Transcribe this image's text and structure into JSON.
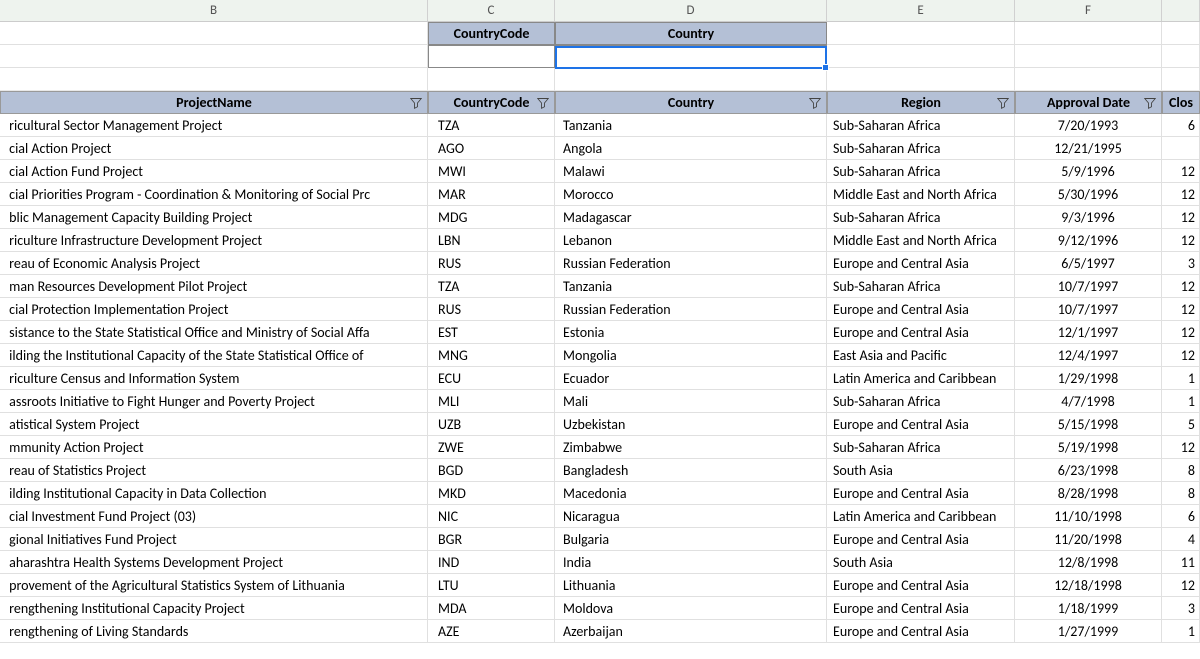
{
  "column_letters": {
    "b": "B",
    "c": "C",
    "d": "D",
    "e": "E",
    "f": "F",
    "g": ""
  },
  "mini_header": {
    "country_code": "CountryCode",
    "country": "Country"
  },
  "table_headers": {
    "project_name": "ProjectName",
    "country_code": "CountryCode",
    "country": "Country",
    "region": "Region",
    "approval_date": "Approval Date",
    "closing": "Clos"
  },
  "rows": [
    {
      "project": "ricultural Sector Management Project",
      "code": "TZA",
      "country": "Tanzania",
      "region": "Sub-Saharan Africa",
      "date": "7/20/1993",
      "tail": "6"
    },
    {
      "project": "cial Action Project",
      "code": "AGO",
      "country": "Angola",
      "region": "Sub-Saharan Africa",
      "date": "12/21/1995",
      "tail": ""
    },
    {
      "project": "cial Action Fund Project",
      "code": "MWI",
      "country": "Malawi",
      "region": "Sub-Saharan Africa",
      "date": "5/9/1996",
      "tail": "12"
    },
    {
      "project": "cial Priorities Program - Coordination & Monitoring of Social Prc",
      "code": "MAR",
      "country": "Morocco",
      "region": "Middle East and North Africa",
      "date": "5/30/1996",
      "tail": "12"
    },
    {
      "project": "blic Management Capacity Building Project",
      "code": "MDG",
      "country": "Madagascar",
      "region": "Sub-Saharan Africa",
      "date": "9/3/1996",
      "tail": "12"
    },
    {
      "project": "riculture Infrastructure Development Project",
      "code": "LBN",
      "country": "Lebanon",
      "region": "Middle East and North Africa",
      "date": "9/12/1996",
      "tail": "12"
    },
    {
      "project": "reau of Economic Analysis Project",
      "code": "RUS",
      "country": "Russian Federation",
      "region": "Europe and Central Asia",
      "date": "6/5/1997",
      "tail": "3"
    },
    {
      "project": "man Resources Development Pilot Project",
      "code": "TZA",
      "country": "Tanzania",
      "region": "Sub-Saharan Africa",
      "date": "10/7/1997",
      "tail": "12"
    },
    {
      "project": "cial Protection Implementation  Project",
      "code": "RUS",
      "country": "Russian Federation",
      "region": "Europe and Central Asia",
      "date": "10/7/1997",
      "tail": "12"
    },
    {
      "project": "sistance to the State Statistical Office and Ministry of Social Affa",
      "code": "EST",
      "country": "Estonia",
      "region": "Europe and Central Asia",
      "date": "12/1/1997",
      "tail": "12"
    },
    {
      "project": "ilding the Institutional Capacity of the State Statistical Office of",
      "code": "MNG",
      "country": "Mongolia",
      "region": "East Asia and Pacific",
      "date": "12/4/1997",
      "tail": "12"
    },
    {
      "project": "riculture Census and Information System",
      "code": "ECU",
      "country": "Ecuador",
      "region": "Latin America and Caribbean",
      "date": "1/29/1998",
      "tail": "1"
    },
    {
      "project": "assroots Initiative to Fight Hunger and Poverty Project",
      "code": "MLI",
      "country": "Mali",
      "region": "Sub-Saharan Africa",
      "date": "4/7/1998",
      "tail": "1"
    },
    {
      "project": "atistical System Project",
      "code": "UZB",
      "country": "Uzbekistan",
      "region": "Europe and Central Asia",
      "date": "5/15/1998",
      "tail": "5"
    },
    {
      "project": "mmunity Action Project",
      "code": "ZWE",
      "country": "Zimbabwe",
      "region": "Sub-Saharan Africa",
      "date": "5/19/1998",
      "tail": "12"
    },
    {
      "project": "reau of Statistics Project",
      "code": "BGD",
      "country": "Bangladesh",
      "region": "South Asia",
      "date": "6/23/1998",
      "tail": "8"
    },
    {
      "project": "ilding Institutional Capacity in Data Collection",
      "code": "MKD",
      "country": "Macedonia",
      "region": "Europe and Central Asia",
      "date": "8/28/1998",
      "tail": "8"
    },
    {
      "project": "cial Investment Fund Project (03)",
      "code": "NIC",
      "country": "Nicaragua",
      "region": "Latin America and Caribbean",
      "date": "11/10/1998",
      "tail": "6"
    },
    {
      "project": "gional Initiatives Fund Project",
      "code": "BGR",
      "country": "Bulgaria",
      "region": "Europe and Central Asia",
      "date": "11/20/1998",
      "tail": "4"
    },
    {
      "project": "aharashtra Health Systems Development Project",
      "code": "IND",
      "country": "India",
      "region": "South Asia",
      "date": "12/8/1998",
      "tail": "11"
    },
    {
      "project": "provement of the Agricultural Statistics System of Lithuania",
      "code": "LTU",
      "country": "Lithuania",
      "region": "Europe and Central Asia",
      "date": "12/18/1998",
      "tail": "12"
    },
    {
      "project": "rengthening Institutional Capacity Project",
      "code": "MDA",
      "country": "Moldova",
      "region": "Europe and Central Asia",
      "date": "1/18/1999",
      "tail": "3"
    },
    {
      "project": "rengthening of Living Standards",
      "code": "AZE",
      "country": "Azerbaijan",
      "region": "Europe and Central Asia",
      "date": "1/27/1999",
      "tail": "1"
    }
  ]
}
